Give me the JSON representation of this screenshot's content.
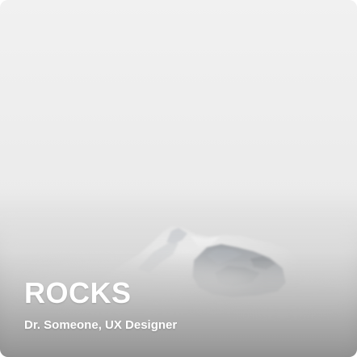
{
  "card": {
    "title": "ROCKS",
    "subtitle": "Dr. Someone, UX Designer"
  },
  "image": {
    "subject": "snowy mountain peak in fog",
    "text_color": "#ffffff"
  }
}
